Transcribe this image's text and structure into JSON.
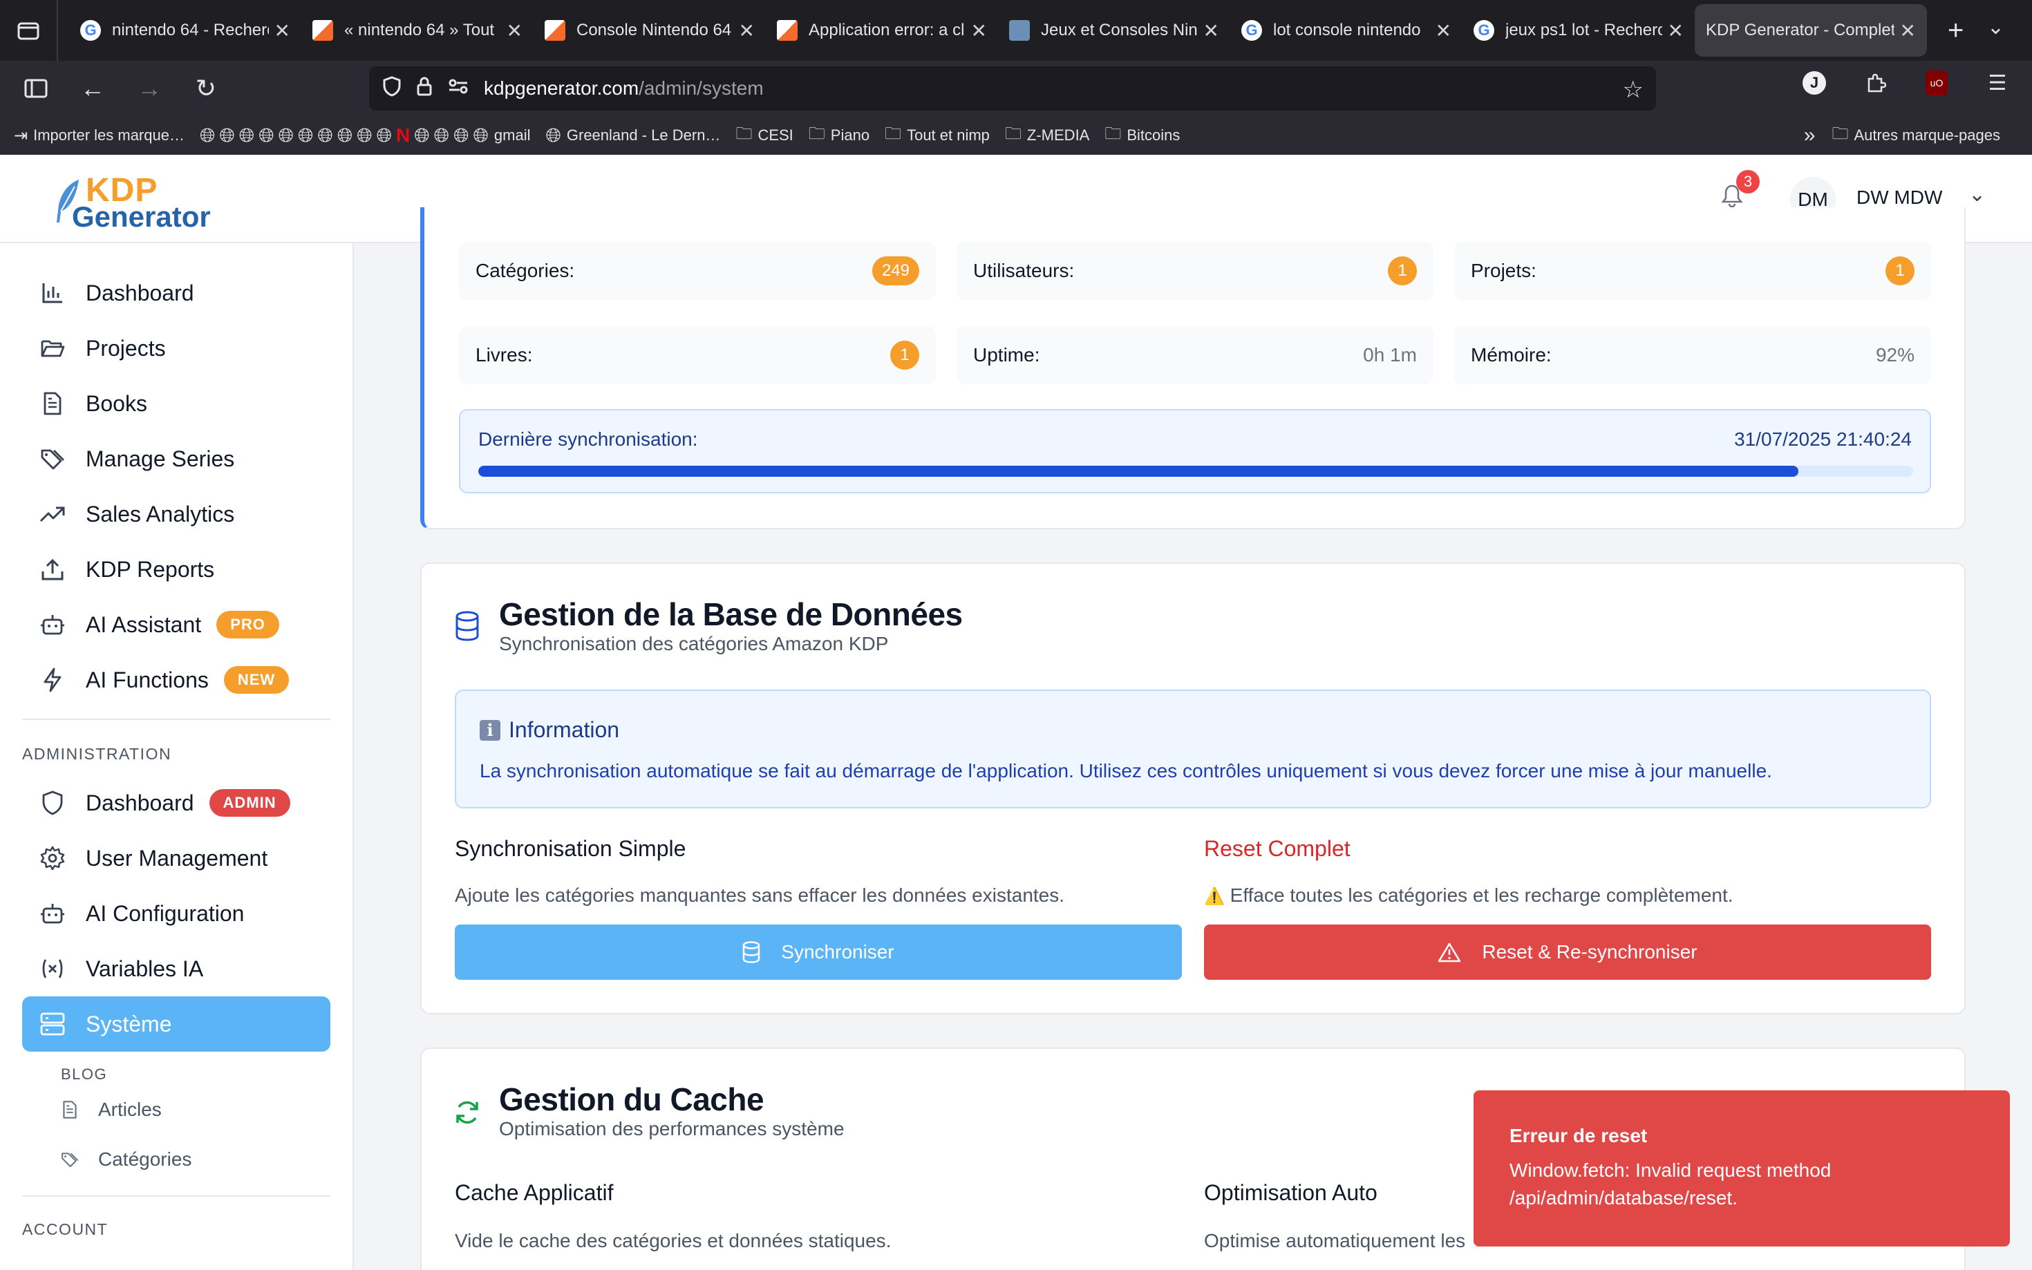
{
  "browser": {
    "tabs": [
      {
        "title": "nintendo 64 - Recherche",
        "favicon_color": "#ffffff",
        "favicon": "google"
      },
      {
        "title": "« nintendo 64 » Tout",
        "favicon_color": "#f4a261",
        "favicon": "leboncoin"
      },
      {
        "title": "Console Nintendo 64",
        "favicon_color": "#f4a261",
        "favicon": "leboncoin"
      },
      {
        "title": "Application error: a cl",
        "favicon_color": "#f4a261",
        "favicon": "leboncoin"
      },
      {
        "title": "Jeux et Consoles Nin",
        "favicon_color": "#6b8fb5",
        "favicon": "image"
      },
      {
        "title": "lot console nintendo",
        "favicon_color": "#ffffff",
        "favicon": "google"
      },
      {
        "title": "jeux ps1 lot - Recherc",
        "favicon_color": "#ffffff",
        "favicon": "google"
      },
      {
        "title": "KDP Generator - Complet",
        "favicon_color": "",
        "favicon": "none",
        "active": true
      }
    ],
    "url_host": "kdpgenerator.com",
    "url_path": "/admin/system",
    "bookmarks": {
      "import": "Importer les marque…",
      "gmail": "gmail",
      "greenland": "Greenland - Le Dern…",
      "folders": [
        "CESI",
        "Piano",
        "Tout et nimp",
        "Z-MEDIA",
        "Bitcoins"
      ],
      "other": "Autres marque-pages"
    },
    "ext_j": "J",
    "ext_ub": "uO"
  },
  "header": {
    "logo_kdp": "KDP",
    "logo_gen": "Generator",
    "notif_count": "3",
    "avatar": "DM",
    "user_name": "DW MDW"
  },
  "sidebar": {
    "items": [
      {
        "label": "Dashboard",
        "icon": "bar-chart-icon"
      },
      {
        "label": "Projects",
        "icon": "folder-open-icon"
      },
      {
        "label": "Books",
        "icon": "document-icon"
      },
      {
        "label": "Manage Series",
        "icon": "tags-icon"
      },
      {
        "label": "Sales Analytics",
        "icon": "trending-up-icon"
      },
      {
        "label": "KDP Reports",
        "icon": "upload-icon"
      },
      {
        "label": "AI Assistant",
        "icon": "robot-icon",
        "badge": "PRO"
      },
      {
        "label": "AI Functions",
        "icon": "lightning-icon",
        "badge": "NEW"
      }
    ],
    "admin_heading": "ADMINISTRATION",
    "admin_items": [
      {
        "label": "Dashboard",
        "icon": "shield-icon",
        "badge": "ADMIN"
      },
      {
        "label": "User Management",
        "icon": "gear-icon"
      },
      {
        "label": "AI Configuration",
        "icon": "robot-icon"
      },
      {
        "label": "Variables IA",
        "icon": "variable-icon"
      },
      {
        "label": "Système",
        "icon": "server-icon",
        "active": true
      }
    ],
    "blog_heading": "BLOG",
    "blog_items": [
      {
        "label": "Articles",
        "icon": "document-icon"
      },
      {
        "label": "Catégories",
        "icon": "tags-icon"
      }
    ],
    "account_heading": "ACCOUNT"
  },
  "stats": {
    "categories": {
      "label": "Catégories:",
      "value": "249"
    },
    "users": {
      "label": "Utilisateurs:",
      "value": "1"
    },
    "projects": {
      "label": "Projets:",
      "value": "1"
    },
    "books": {
      "label": "Livres:",
      "value": "1"
    },
    "uptime": {
      "label": "Uptime:",
      "value": "0h 1m"
    },
    "memory": {
      "label": "Mémoire:",
      "value": "92%"
    }
  },
  "sync": {
    "label": "Dernière synchronisation:",
    "date": "31/07/2025 21:40:24",
    "progress_fraction": 0.92
  },
  "database": {
    "title": "Gestion de la Base de Données",
    "subtitle": "Synchronisation des catégories Amazon KDP",
    "info_title": "Information",
    "info_text": "La synchronisation automatique se fait au démarrage de l'application. Utilisez ces contrôles uniquement si vous devez forcer une mise à jour manuelle.",
    "simple_title": "Synchronisation Simple",
    "simple_desc": "Ajoute les catégories manquantes sans effacer les données existantes.",
    "simple_button": "Synchroniser",
    "reset_title": "Reset Complet",
    "reset_desc": "Efface toutes les catégories et les recharge complètement.",
    "reset_warning_glyph": "⚠️",
    "reset_button": "Reset & Re-synchroniser"
  },
  "cache": {
    "title": "Gestion du Cache",
    "subtitle": "Optimisation des performances système",
    "app_title": "Cache Applicatif",
    "app_desc": "Vide le cache des catégories et données statiques.",
    "auto_title": "Optimisation Auto",
    "auto_desc": "Optimise automatiquement les"
  },
  "toast": {
    "title": "Erreur de reset",
    "body": "Window.fetch: Invalid request method /api/admin/database/reset."
  },
  "colors": {
    "accent_blue": "#5ab4f5",
    "danger_red": "#e04848",
    "badge_orange": "#f59e2c"
  }
}
